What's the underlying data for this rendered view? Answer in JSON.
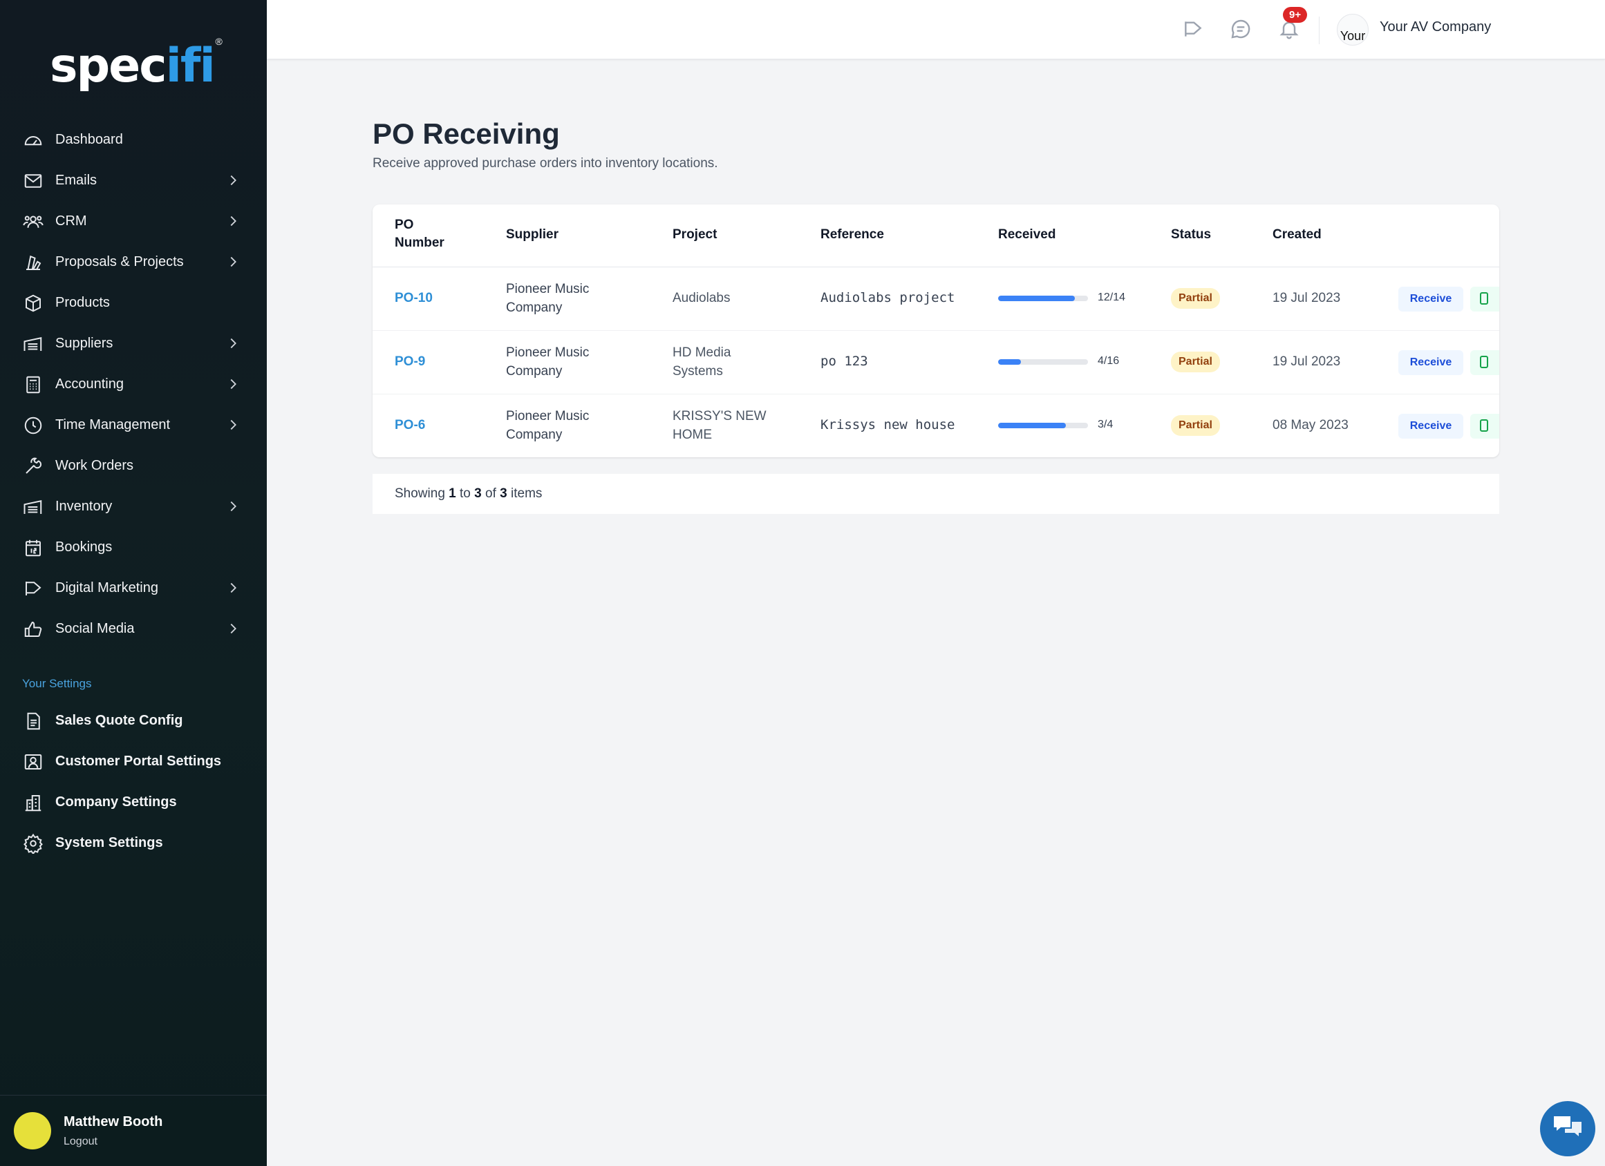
{
  "brand": {
    "logo_main": "spec",
    "logo_accent": "ifi",
    "logo_reg": "®"
  },
  "sidebar": {
    "items": [
      {
        "label": "Dashboard",
        "icon": "gauge-icon",
        "chevron": false
      },
      {
        "label": "Emails",
        "icon": "envelope-icon",
        "chevron": true
      },
      {
        "label": "CRM",
        "icon": "users-icon",
        "chevron": true
      },
      {
        "label": "Proposals & Projects",
        "icon": "documents-icon",
        "chevron": true
      },
      {
        "label": "Products",
        "icon": "box-icon",
        "chevron": false
      },
      {
        "label": "Suppliers",
        "icon": "warehouse-icon",
        "chevron": true
      },
      {
        "label": "Accounting",
        "icon": "calculator-icon",
        "chevron": true
      },
      {
        "label": "Time Management",
        "icon": "clock-icon",
        "chevron": true
      },
      {
        "label": "Work Orders",
        "icon": "tools-icon",
        "chevron": false
      },
      {
        "label": "Inventory",
        "icon": "warehouse-icon",
        "chevron": true
      },
      {
        "label": "Bookings",
        "icon": "calendar-icon",
        "chevron": false
      },
      {
        "label": "Digital Marketing",
        "icon": "megaphone-icon",
        "chevron": true
      },
      {
        "label": "Social Media",
        "icon": "thumbs-up-icon",
        "chevron": true
      }
    ],
    "settings_heading": "Your Settings",
    "settings": [
      {
        "label": "Sales Quote Config",
        "icon": "document-icon"
      },
      {
        "label": "Customer Portal Settings",
        "icon": "portrait-icon"
      },
      {
        "label": "Company Settings",
        "icon": "building-icon"
      },
      {
        "label": "System Settings",
        "icon": "gear-icon"
      }
    ],
    "user": {
      "name": "Matthew Booth",
      "logout": "Logout"
    }
  },
  "topbar": {
    "notification_badge": "9+",
    "company_avatar_alt": "Your",
    "company_name": "Your AV Company",
    "icons": [
      "megaphone-icon",
      "chat-icon",
      "bell-icon"
    ]
  },
  "page": {
    "title": "PO Receiving",
    "subtitle": "Receive approved purchase orders into inventory locations."
  },
  "table": {
    "headers": {
      "po_line1": "PO",
      "po_line2": "Number",
      "supplier": "Supplier",
      "project": "Project",
      "reference": "Reference",
      "received": "Received",
      "status": "Status",
      "created": "Created"
    },
    "rows": [
      {
        "po": "PO-10",
        "supplier_l1": "Pioneer Music",
        "supplier_l2": "Company",
        "project_l1": "Audiolabs",
        "project_l2": "",
        "reference": "Audiolabs project",
        "received": "12/14",
        "received_fraction": 0.857,
        "status": "Partial",
        "created": "19 Jul 2023",
        "action": "Receive"
      },
      {
        "po": "PO-9",
        "supplier_l1": "Pioneer Music",
        "supplier_l2": "Company",
        "project_l1": "HD Media",
        "project_l2": "Systems",
        "reference": "po 123",
        "received": "4/16",
        "received_fraction": 0.25,
        "status": "Partial",
        "created": "19 Jul 2023",
        "action": "Receive"
      },
      {
        "po": "PO-6",
        "supplier_l1": "Pioneer Music",
        "supplier_l2": "Company",
        "project_l1": "KRISSY'S NEW",
        "project_l2": "HOME",
        "reference": "Krissys new house",
        "received": "3/4",
        "received_fraction": 0.75,
        "status": "Partial",
        "created": "08 May 2023",
        "action": "Receive"
      }
    ]
  },
  "footer": {
    "showing": "Showing",
    "from": "1",
    "to_word": "to",
    "to": "3",
    "of_word": "of",
    "total": "3",
    "items_word": "items"
  },
  "colors": {
    "accent": "#2e8fd6",
    "progress": "#3b82f6",
    "partial_bg": "#fef3c7",
    "sidebar_bg": "#111a22"
  }
}
